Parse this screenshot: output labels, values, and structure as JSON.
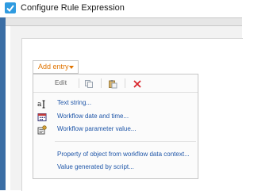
{
  "window": {
    "title": "Configure Rule Expression"
  },
  "add_entry": {
    "label": "Add entry"
  },
  "menu": {
    "toolbar": {
      "edit_label": "Edit"
    },
    "items": [
      {
        "label": "Text string...",
        "icon": "text-string-icon"
      },
      {
        "label": "Workflow date and time...",
        "icon": "calendar-icon"
      },
      {
        "label": "Workflow parameter value...",
        "icon": "parameter-icon"
      },
      {
        "label": "Property of object from workflow data context...",
        "icon": ""
      },
      {
        "label": "Value generated by script...",
        "icon": ""
      }
    ]
  },
  "colors": {
    "accent": "#e07400",
    "link": "#1f56a8",
    "frame": "#3b6ea5",
    "delete": "#d9262c"
  }
}
